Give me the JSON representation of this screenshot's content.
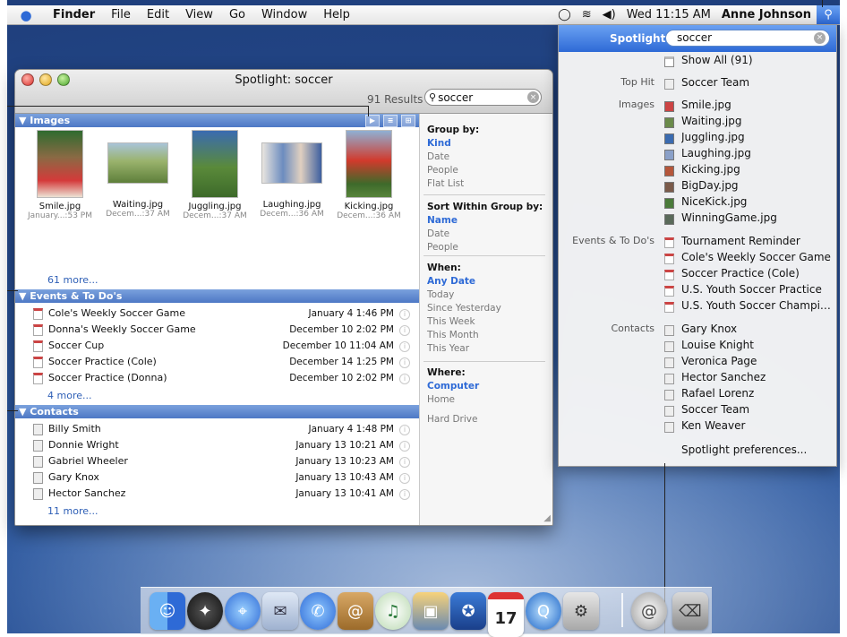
{
  "menubar": {
    "apple": "",
    "items": [
      "Finder",
      "File",
      "Edit",
      "View",
      "Go",
      "Window",
      "Help"
    ],
    "clock": "Wed 11:15 AM",
    "user": "Anne Johnson"
  },
  "window": {
    "title": "Spotlight: soccer",
    "result_count": "91 Results",
    "search_value": "soccer",
    "images_header": "Images",
    "images": [
      {
        "name": "Smile.jpg",
        "date": "January...:53 PM"
      },
      {
        "name": "Waiting.jpg",
        "date": "Decem...:37 AM"
      },
      {
        "name": "Juggling.jpg",
        "date": "Decem...:37 AM"
      },
      {
        "name": "Laughing.jpg",
        "date": "Decem...:36 AM"
      },
      {
        "name": "Kicking.jpg",
        "date": "Decem...:36 AM"
      }
    ],
    "images_more": "61 more...",
    "events_header": "Events & To Do's",
    "events": [
      {
        "name": "Cole's Weekly Soccer Game",
        "date": "January 4 1:46 PM"
      },
      {
        "name": "Donna's Weekly Soccer Game",
        "date": "December 10 2:02 PM"
      },
      {
        "name": "Soccer Cup",
        "date": "December 10 11:04 AM"
      },
      {
        "name": "Soccer Practice (Cole)",
        "date": "December 14 1:25 PM"
      },
      {
        "name": "Soccer Practice (Donna)",
        "date": "December 10 2:02 PM"
      }
    ],
    "events_more": "4 more...",
    "contacts_header": "Contacts",
    "contacts": [
      {
        "name": "Billy Smith",
        "date": "January 4 1:48 PM"
      },
      {
        "name": "Donnie Wright",
        "date": "January 13 10:21 AM"
      },
      {
        "name": "Gabriel Wheeler",
        "date": "January 13 10:23 AM"
      },
      {
        "name": "Gary Knox",
        "date": "January 13 10:43 AM"
      },
      {
        "name": "Hector Sanchez",
        "date": "January 13 10:41 AM"
      }
    ],
    "contacts_more": "11 more...",
    "sidebar": {
      "group_by": {
        "label": "Group by:",
        "options": [
          "Kind",
          "Date",
          "People",
          "Flat List"
        ],
        "selected": 0
      },
      "sort_within": {
        "label": "Sort Within Group by:",
        "options": [
          "Name",
          "Date",
          "People"
        ],
        "selected": 0
      },
      "when": {
        "label": "When:",
        "options": [
          "Any Date",
          "Today",
          "Since Yesterday",
          "This Week",
          "This Month",
          "This Year"
        ],
        "selected": 0
      },
      "where": {
        "label": "Where:",
        "options": [
          "Computer",
          "Home"
        ],
        "selected": 0
      },
      "hard_drive": "Hard Drive"
    }
  },
  "spotlight_menu": {
    "label": "Spotlight",
    "query": "soccer",
    "show_all": "Show All (91)",
    "top_hit_label": "Top Hit",
    "top_hit": "Soccer Team",
    "images_label": "Images",
    "images": [
      "Smile.jpg",
      "Waiting.jpg",
      "Juggling.jpg",
      "Laughing.jpg",
      "Kicking.jpg",
      "BigDay.jpg",
      "NiceKick.jpg",
      "WinningGame.jpg"
    ],
    "events_label": "Events & To Do's",
    "events": [
      "Tournament Reminder",
      "Cole's Weekly Soccer Game",
      "Soccer Practice (Cole)",
      "U.S. Youth Soccer Practice",
      "U.S. Youth Soccer Champion..."
    ],
    "contacts_label": "Contacts",
    "contacts": [
      "Gary Knox",
      "Louise Knight",
      "Veronica Page",
      "Hector Sanchez",
      "Rafael Lorenz",
      "Soccer Team",
      "Ken Weaver"
    ],
    "preferences": "Spotlight preferences..."
  },
  "dock": {
    "icons": [
      "finder-icon",
      "dashboard-icon",
      "safari-icon",
      "mail-icon",
      "ichat-icon",
      "address-book-icon",
      "itunes-icon",
      "iphoto-icon",
      "imovie-icon",
      "ical-icon",
      "quicktime-icon",
      "system-preferences-icon",
      "internet-connect-icon",
      "trash-icon"
    ],
    "ical_day": "17"
  }
}
